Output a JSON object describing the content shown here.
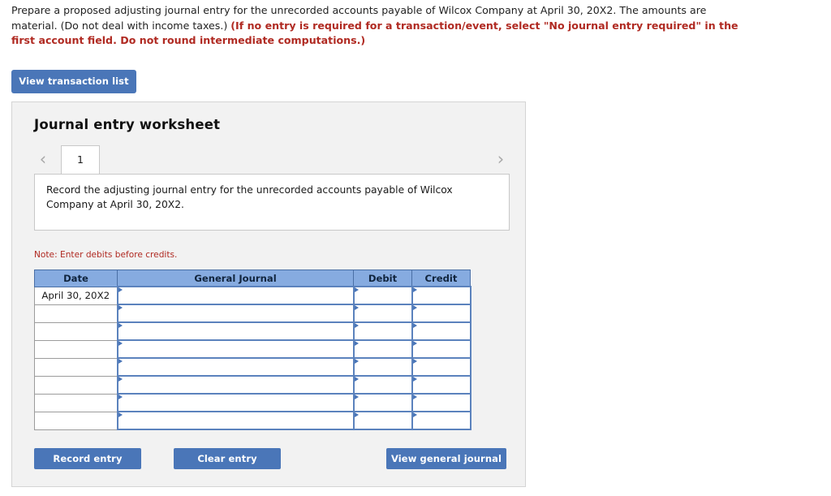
{
  "prompt": {
    "plain_part_1": "Prepare a proposed adjusting journal entry for the unrecorded accounts payable of Wilcox Company at April 30, 20X2. The amounts are material. (Do not deal with income taxes.) ",
    "emphasis_part": "(If no entry is required for a transaction/event, select \"No journal entry required\" in the first account field. Do not round intermediate computations.)",
    "emphasis_color": "#b02a22"
  },
  "toolbar": {
    "view_transaction_list_label": "View transaction list"
  },
  "worksheet": {
    "title": "Journal entry worksheet",
    "nav": {
      "prev_icon": "‹",
      "next_icon": "›"
    },
    "tabs": [
      {
        "label": "1",
        "active": true
      }
    ],
    "instruction": "Record the adjusting journal entry for the unrecorded accounts payable of Wilcox Company at April 30, 20X2.",
    "note": "Note: Enter debits before credits.",
    "table": {
      "headers": [
        "Date",
        "General Journal",
        "Debit",
        "Credit"
      ],
      "rows": [
        {
          "date": "April 30, 20X2",
          "general_journal": "",
          "debit": "",
          "credit": ""
        },
        {
          "date": "",
          "general_journal": "",
          "debit": "",
          "credit": ""
        },
        {
          "date": "",
          "general_journal": "",
          "debit": "",
          "credit": ""
        },
        {
          "date": "",
          "general_journal": "",
          "debit": "",
          "credit": ""
        },
        {
          "date": "",
          "general_journal": "",
          "debit": "",
          "credit": ""
        },
        {
          "date": "",
          "general_journal": "",
          "debit": "",
          "credit": ""
        },
        {
          "date": "",
          "general_journal": "",
          "debit": "",
          "credit": ""
        },
        {
          "date": "",
          "general_journal": "",
          "debit": "",
          "credit": ""
        }
      ]
    },
    "actions": {
      "record_entry_label": "Record entry",
      "clear_entry_label": "Clear entry",
      "view_general_journal_label": "View general journal"
    }
  },
  "colors": {
    "button_blue": "#4a76b8",
    "header_blue": "#86abe0",
    "panel_gray": "#f2f2f2",
    "note_red": "#b02a22"
  }
}
